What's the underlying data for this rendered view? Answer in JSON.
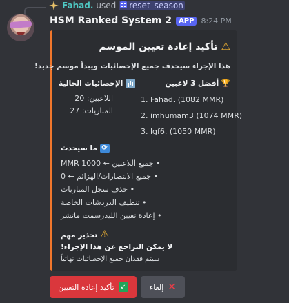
{
  "reply": {
    "avatar_icon": "sparkle-user-icon",
    "username": "Fahad.",
    "used": "used",
    "command_icon": "slash-command-icon",
    "command": "reset_season"
  },
  "header": {
    "bot_name": "HSM Ranked System 2",
    "app_tag": "APP",
    "timestamp": "8:24 PM"
  },
  "embed": {
    "accent_color": "#f1772c",
    "title": "تأكيد إعادة تعيين الموسم",
    "title_icon": "warning-icon",
    "description": "هذا الإجراء سيحذف جميع الإحصائيات ويبدأ موسم جديد!",
    "top_players": {
      "name": "أفضل 3 لاعبين",
      "icon": "trophy-icon",
      "lines": [
        "1. Fahad. (1082 MMR)",
        "2. imhumam3 (1074 MMR)",
        "3. lgf6. (1050 MMR)"
      ]
    },
    "current_stats": {
      "name": "الإحصائيات الحالية",
      "icon": "bar-chart-icon",
      "lines": [
        "اللاعبين: 20",
        "المباريات: 27"
      ]
    },
    "will_be": {
      "name": "ما سيحدث",
      "icon": "cycle-icon",
      "lines": [
        "• جميع اللاعبين ← MMR 1000",
        "• جميع الانتصارات/الهزائم ← 0",
        "• حذف سجل المباريات",
        "• تنظيف الدردشات الخاصة",
        "• إعادة تعيين الليدرسمت ماتشر"
      ]
    },
    "warning": {
      "name": "تحذير مهم",
      "icon": "warning-icon",
      "bold_line": "لا يمكن التراجع عن هذا الإجراء!",
      "line": "سيتم فقدان جميع الإحصائيات نهائياً"
    }
  },
  "buttons": {
    "confirm_label": "تأكيد إعادة التعيين",
    "confirm_icon": "check-icon",
    "cancel_label": "إلغاء",
    "cancel_icon": "x-icon"
  }
}
